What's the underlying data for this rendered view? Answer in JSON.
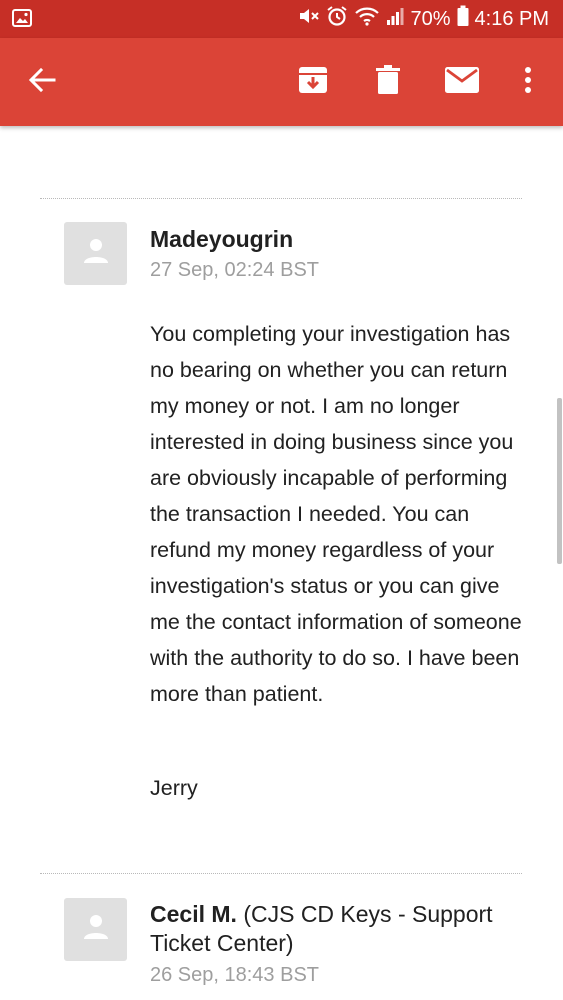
{
  "status_bar": {
    "battery": "70%",
    "time": "4:16 PM",
    "icons": [
      "gallery-icon",
      "mute-icon",
      "alarm-icon",
      "wifi-icon",
      "signal-icon",
      "battery-icon"
    ]
  },
  "toolbar": {
    "icons": [
      "back-arrow-icon",
      "archive-icon",
      "delete-icon",
      "mail-icon",
      "more-vert-icon"
    ]
  },
  "messages": [
    {
      "sender": "Madeyougrin",
      "date": "27 Sep, 02:24 BST",
      "body": "You completing your investigation has no bearing on whether you can return my money or not. I am no longer interested in doing business since you are obviously incapable of performing the transaction I needed. You can refund my money regardless of your investigation's status or you can give me the contact information of someone with the authority to do so. I have been more than patient.",
      "signature": "Jerry"
    },
    {
      "sender_name": "Cecil M.",
      "sender_org": "(CJS CD Keys - Support Ticket Center)",
      "date": "26 Sep, 18:43 BST"
    }
  ],
  "colors": {
    "status_bar": "#c62f26",
    "app_bar": "#db4437",
    "avatar_bg": "#e0e0e0",
    "date_text": "#9e9e9e"
  }
}
